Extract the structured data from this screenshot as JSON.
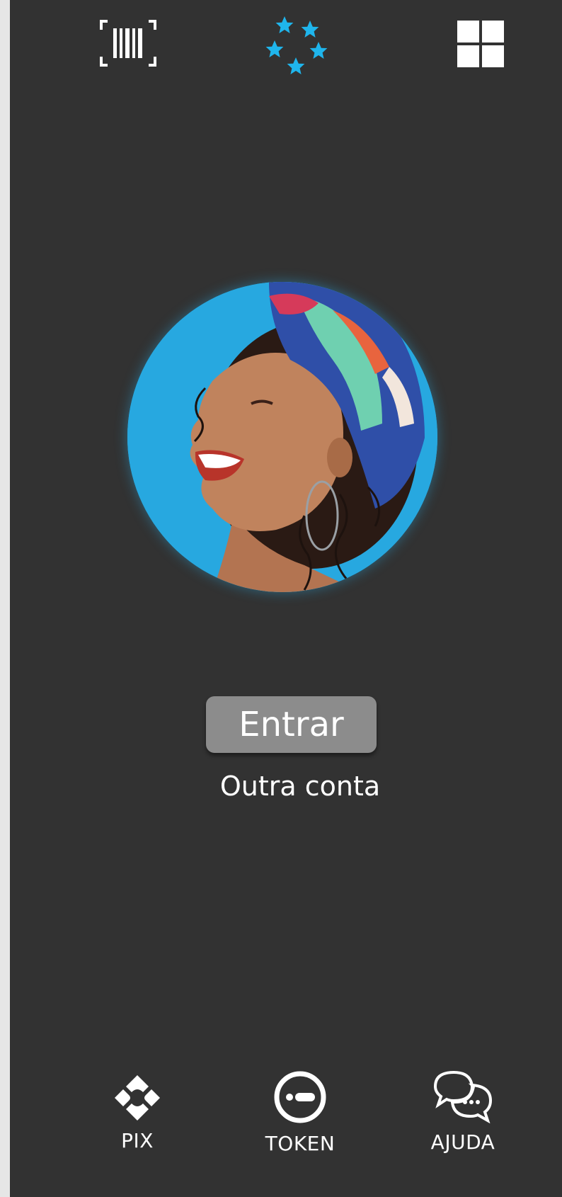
{
  "colors": {
    "background": "#323232",
    "accent_stars": "#1fb5ec",
    "avatar_background": "#27a8e0",
    "enter_button": "#8c8c8c",
    "text": "#ffffff"
  },
  "header": {
    "left_icon": "barcode-scan-icon",
    "center_icon": "stars-logo-icon",
    "right_icon": "apps-grid-icon"
  },
  "main": {
    "avatar": "user-avatar-photo",
    "enter_label": "Entrar",
    "other_account_label": "Outra conta"
  },
  "bottom_nav": {
    "items": [
      {
        "label": "PIX",
        "icon": "pix-icon"
      },
      {
        "label": "TOKEN",
        "icon": "token-icon"
      },
      {
        "label": "AJUDA",
        "icon": "chat-help-icon"
      }
    ]
  }
}
